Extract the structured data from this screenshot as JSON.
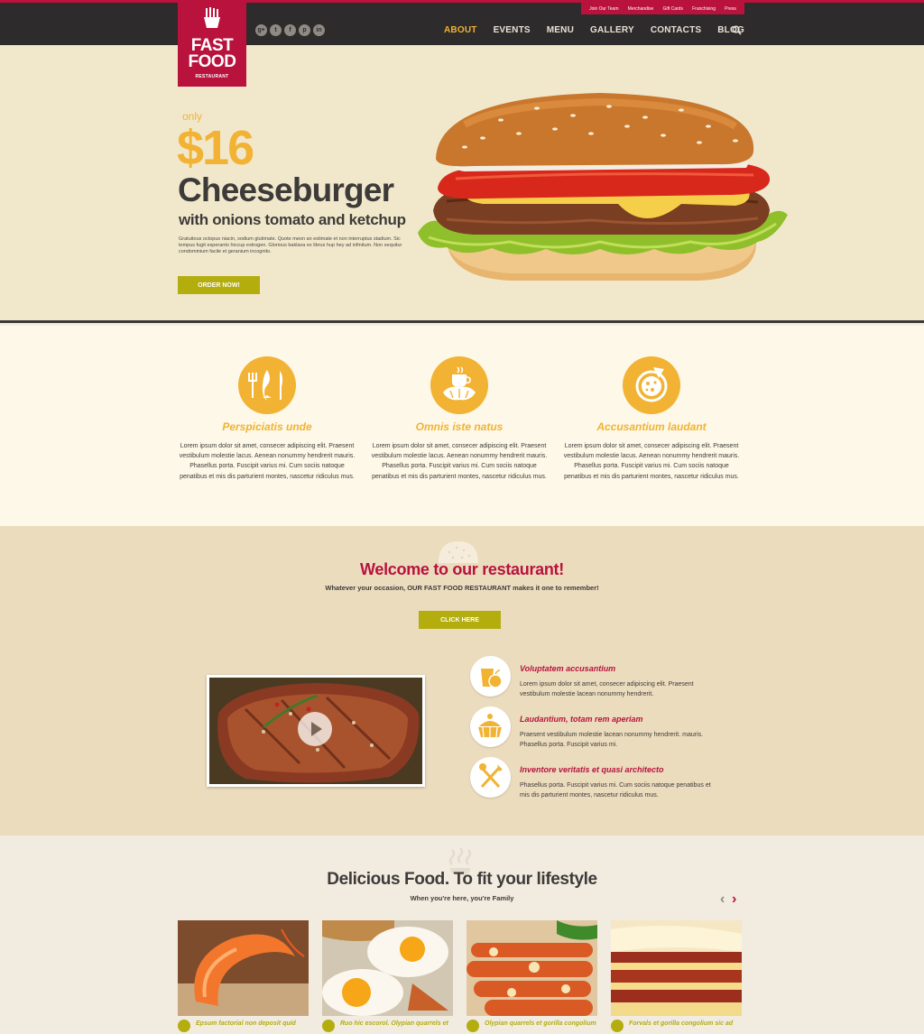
{
  "header": {
    "top_links": [
      "Join Our Team",
      "Merchandise",
      "Gift Cards",
      "Franchising",
      "Press"
    ],
    "logo": {
      "line1": "FAST",
      "line2": "FOOD",
      "line3": "RESTAURANT"
    },
    "socials": [
      "g+",
      "t",
      "f",
      "p",
      "in"
    ],
    "nav": [
      {
        "label": "ABOUT",
        "active": true
      },
      {
        "label": "EVENTS"
      },
      {
        "label": "MENU"
      },
      {
        "label": "GALLERY"
      },
      {
        "label": "CONTACTS"
      },
      {
        "label": "BLOG"
      }
    ],
    "search_icon": "search-icon"
  },
  "hero": {
    "only": "only",
    "price": "$16",
    "title": "Cheeseburger",
    "subtitle": "with onions tomato and ketchup",
    "description": "Gratuitous octopus niacin, sodium glutimate. Quote meon an estimate et non interruptus stadium. Sic tempus fugit esperanto hiccup estrogen. Glorious baklava ex librus hup hey ad infinitum. Non sequitur condominium facile et geranium incognito.",
    "button": "ORDER NOW!",
    "slides": 3,
    "active_slide": 1
  },
  "features": [
    {
      "icon": "fork-fish-knife-icon",
      "title": "Perspiciatis unde",
      "text": "Lorem ipsum dolor sit amet, consecer adipiscing elit. Praesent vestibulum molestie lacus. Aenean nonummy hendrerit mauris. Phasellus porta. Fuscipit varius mi. Cum sociis natoque penatibus et mis dis parturient montes, nascetur ridiculus mus."
    },
    {
      "icon": "coffee-croissant-icon",
      "title": "Omnis iste natus",
      "text": "Lorem ipsum dolor sit amet, consecer adipiscing elit. Praesent vestibulum molestie lacus. Aenean nonummy hendrerit mauris. Phasellus porta. Fuscipit varius mi. Cum sociis natoque penatibus et mis dis parturient montes, nascetur ridiculus mus."
    },
    {
      "icon": "pizza-icon",
      "title": "Accusantium laudant",
      "text": "Lorem ipsum dolor sit amet, consecer adipiscing elit. Praesent vestibulum molestie lacus. Aenean nonummy hendrerit mauris. Phasellus porta. Fuscipit varius mi. Cum sociis natoque penatibus et mis dis parturient montes, nascetur ridiculus mus."
    }
  ],
  "welcome": {
    "title": "Welcome to our restaurant!",
    "subtitle": "Whatever your occasion, OUR FAST FOOD RESTAURANT makes it one to remember!",
    "button": "CLICK HERE",
    "items": [
      {
        "icon": "fruit-icon",
        "title": "Voluptatem accusantium",
        "text": "Lorem ipsum dolor sit amet, consecer adipiscing elit. Praesent vestibulum molestie lacean nonummy hendrerit."
      },
      {
        "icon": "cake-icon",
        "title": "Laudantium, totam rem aperiam",
        "text": "Praesent vestibulum molestie lacean nonummy hendrerit. mauris. Phasellus porta. Fuscipit varius mi."
      },
      {
        "icon": "fork-knife-icon",
        "title": "Inventore veritatis et quasi architecto",
        "text": "Phasellus porta. Fuscipit varius mi. Cum sociis natoque penatibus et mis dis parturient montes, nascetur ridiculus mus."
      }
    ]
  },
  "delicious": {
    "title": "Delicious Food. To fit your lifestyle",
    "subtitle": "When you're here, you're Family",
    "cards": [
      {
        "label": "Epsum factorial non deposit quid"
      },
      {
        "label": "Ruo hic escorol. Olypian quarrels et"
      },
      {
        "label": "Olypian quarrels et gorilla congolium"
      },
      {
        "label": "Forvals et gorilla congolium sic ad"
      }
    ]
  },
  "colors": {
    "brand": "#b8123d",
    "accent": "#f2b233",
    "button": "#b3ad0e",
    "dark": "#2d2b2b"
  }
}
